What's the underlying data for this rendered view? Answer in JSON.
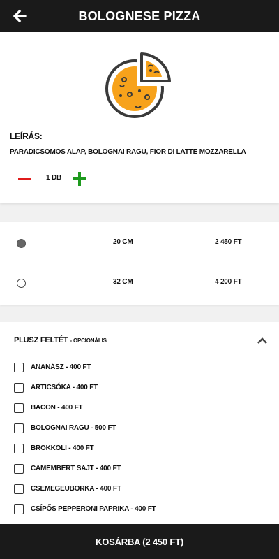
{
  "header": {
    "title": "BOLOGNESE PIZZA",
    "back_icon": "arrow-left-icon"
  },
  "product": {
    "image_icon": "pizza-icon",
    "accent": "#f7a21b",
    "description_label": "LEÍRÁS:",
    "description": "PARADICSOMOS ALAP, BOLOGNAI RAGU, FIOR DI LATTE MOZZARELLA",
    "quantity": "1 DB",
    "minus_color": "#e01b1b",
    "plus_color": "#1e9a1e"
  },
  "sizes": [
    {
      "name": "20 CM",
      "price": "2 450 FT",
      "selected": true
    },
    {
      "name": "32 CM",
      "price": "4 200 FT",
      "selected": false
    }
  ],
  "toppings": {
    "title": "PLUSZ FELTÉT",
    "subtitle": "- OPCIONÁLIS",
    "items": [
      {
        "label": "ANANÁSZ - 400 FT"
      },
      {
        "label": "ARTICSÓKA - 400 FT"
      },
      {
        "label": "BACON - 400 FT"
      },
      {
        "label": "BOLOGNAI RAGU - 500 FT"
      },
      {
        "label": "BROKKOLI - 400 FT"
      },
      {
        "label": "CAMEMBERT SAJT - 400 FT"
      },
      {
        "label": "CSEMEGEUBORKA - 400 FT"
      },
      {
        "label": "CSÍPŐS PEPPERONI PAPRIKA - 400 FT"
      }
    ]
  },
  "footer": {
    "cart_label": "KOSÁRBA (2 450 FT)"
  }
}
